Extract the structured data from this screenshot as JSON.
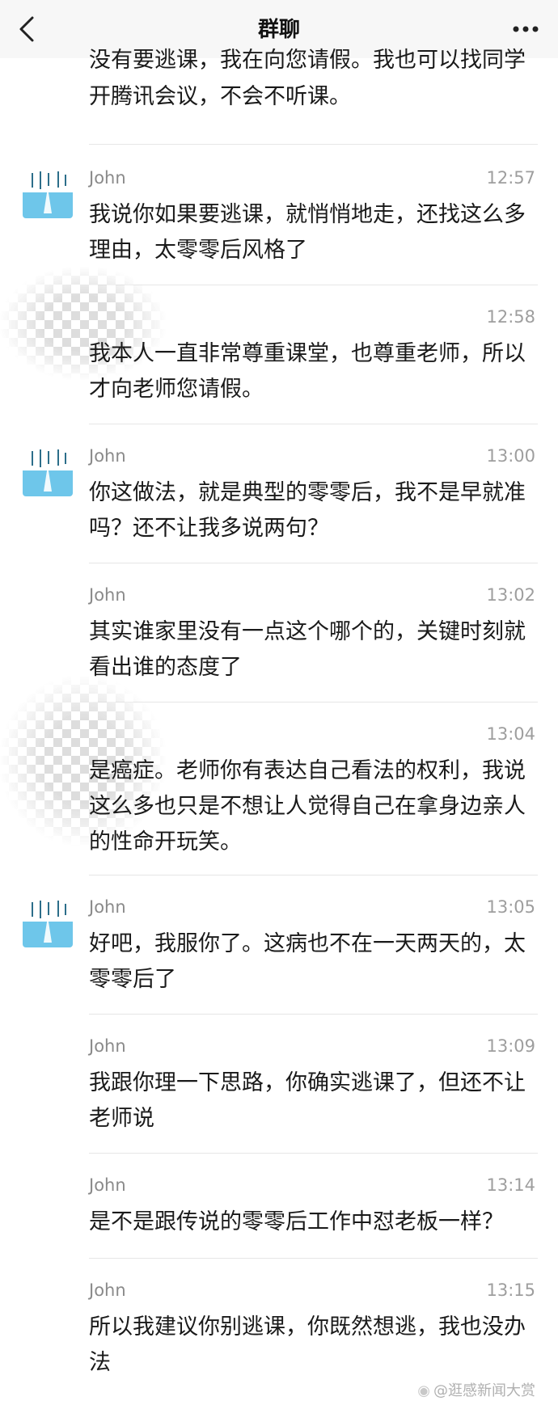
{
  "header": {
    "title": "群聊"
  },
  "partial_message": {
    "text": "没有要逃课，我在向您请假。我也可以找同学开腾讯会议，不会不听课。"
  },
  "messages": [
    {
      "sender": "John",
      "time": "12:57",
      "text": "我说你如果要逃课，就悄悄地走，还找这么多理由，太零零后风格了"
    },
    {
      "sender": "",
      "time": "12:58",
      "text": "我本人一直非常尊重课堂，也尊重老师，所以才向老师您请假。"
    },
    {
      "sender": "John",
      "time": "13:00",
      "text": "你这做法，就是典型的零零后，我不是早就准吗？还不让我多说两句？"
    },
    {
      "sender": "John",
      "time": "13:02",
      "text": "其实谁家里没有一点这个哪个的，关键时刻就看出谁的态度了"
    },
    {
      "sender": "",
      "time": "13:04",
      "text": "是癌症。老师你有表达自己看法的权利，我说这么多也只是不想让人觉得自己在拿身边亲人的性命开玩笑。"
    },
    {
      "sender": "John",
      "time": "13:05",
      "text": "好吧，我服你了。这病也不在一天两天的，太零零后了"
    },
    {
      "sender": "John",
      "time": "13:09",
      "text": "我跟你理一下思路，你确实逃课了，但还不让老师说"
    },
    {
      "sender": "John",
      "time": "13:14",
      "text": "是不是跟传说的零零后工作中怼老板一样？"
    },
    {
      "sender": "John",
      "time": "13:15",
      "text": "所以我建议你别逃课，你既然想逃，我也没办法"
    }
  ],
  "watermark": {
    "text": "@逛感新闻大赏"
  },
  "colors": {
    "header_bg": "#f7f7f7",
    "avatar_sky": "#6ec6ea",
    "divider": "#e6e6e6"
  }
}
